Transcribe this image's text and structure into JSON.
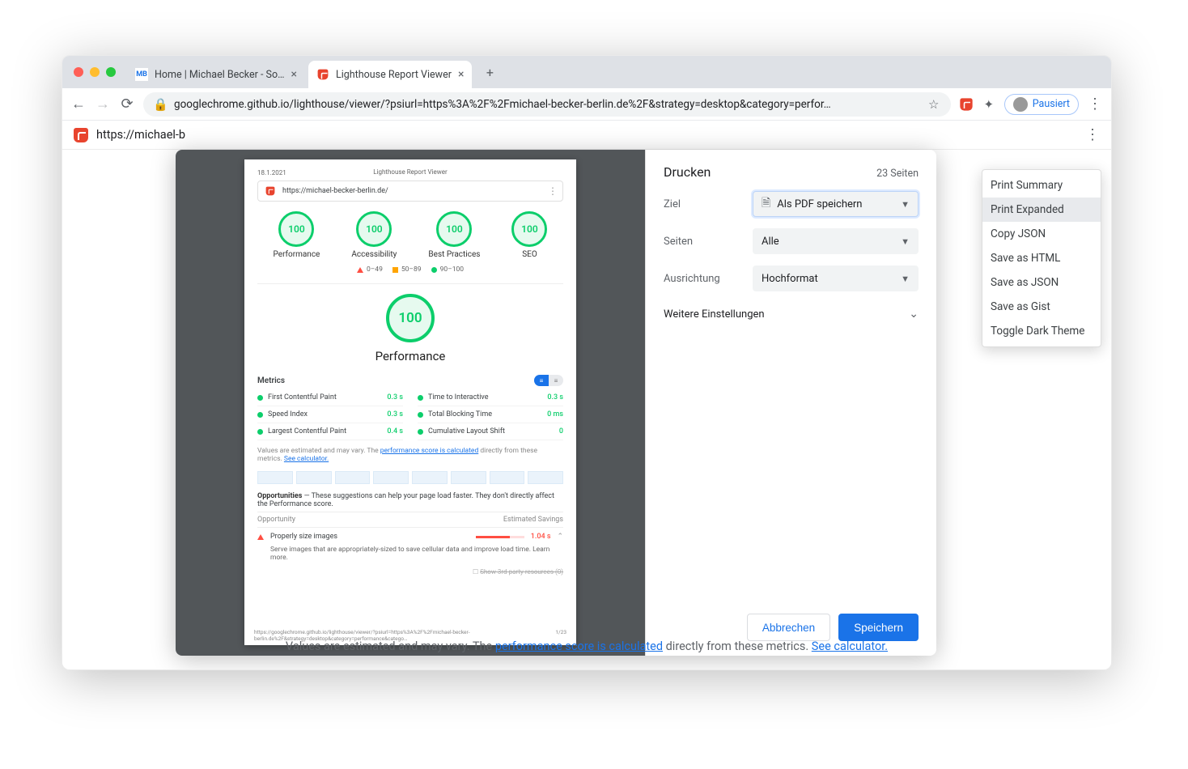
{
  "browser": {
    "tabs": [
      {
        "favicon_text": "MB",
        "title": "Home | Michael Becker - Softw"
      },
      {
        "favicon_text": "🏮",
        "title": "Lighthouse Report Viewer"
      }
    ],
    "url": "googlechrome.github.io/lighthouse/viewer/?psiurl=https%3A%2F%2Fmichael-becker-berlin.de%2F&strategy=desktop&category=perfor…",
    "profile_status": "Pausiert"
  },
  "sub_toolbar": {
    "url_text": "https://michael-b"
  },
  "dropdown": {
    "items": [
      "Print Summary",
      "Print Expanded",
      "Copy JSON",
      "Save as HTML",
      "Save as JSON",
      "Save as Gist",
      "Toggle Dark Theme"
    ],
    "selected_index": 1
  },
  "print": {
    "title": "Drucken",
    "page_count_label": "23 Seiten",
    "dest_label": "Ziel",
    "dest_value": "Als PDF speichern",
    "pages_label": "Seiten",
    "pages_value": "Alle",
    "orient_label": "Ausrichtung",
    "orient_value": "Hochformat",
    "more_label": "Weitere Einstellungen",
    "cancel": "Abbrechen",
    "save": "Speichern"
  },
  "preview": {
    "date": "18.1.2021",
    "title": "Lighthouse Report Viewer",
    "url": "https://michael-becker-berlin.de/",
    "gauges": [
      {
        "score": "100",
        "label": "Performance"
      },
      {
        "score": "100",
        "label": "Accessibility"
      },
      {
        "score": "100",
        "label": "Best Practices"
      },
      {
        "score": "100",
        "label": "SEO"
      }
    ],
    "legend": {
      "fail": "0–49",
      "avg": "50–89",
      "pass": "90–100"
    },
    "big_gauge": {
      "score": "100",
      "label": "Performance"
    },
    "metrics_label": "Metrics",
    "metrics": [
      {
        "name": "First Contentful Paint",
        "value": "0.3 s"
      },
      {
        "name": "Time to Interactive",
        "value": "0.3 s"
      },
      {
        "name": "Speed Index",
        "value": "0.3 s"
      },
      {
        "name": "Total Blocking Time",
        "value": "0 ms"
      },
      {
        "name": "Largest Contentful Paint",
        "value": "0.4 s"
      },
      {
        "name": "Cumulative Layout Shift",
        "value": "0"
      }
    ],
    "disclaimer_prefix": "Values are estimated and may vary. The ",
    "disclaimer_link1": "performance score is calculated",
    "disclaimer_mid": " directly from these metrics. ",
    "disclaimer_link2": "See calculator.",
    "opp_header": "Opportunities",
    "opp_sub": " — These suggestions can help your page load faster. They don't ",
    "opp_link": "directly affect",
    "opp_sub2": " the Performance score.",
    "opp_col_left": "Opportunity",
    "opp_col_right": "Estimated Savings",
    "opp_item": {
      "name": "Properly size images",
      "savings": "1.04 s"
    },
    "opp_detail": "Serve images that are appropriately-sized to save cellular data and improve load time. ",
    "opp_learn": "Learn more.",
    "third_party": "Show 3rd-party resources (0)",
    "footer_left": "https://googlechrome.github.io/lighthouse/viewer/?psiurl=https%3A%2F%2Fmichael-becker-berlin.de%2F&strategy=desktop&category=performance&catego…",
    "footer_right": "1/23"
  },
  "bottom_text": {
    "prefix": "Values are estimated and may vary. The ",
    "link1": "performance score is calculated",
    "mid": " directly from these metrics. ",
    "link2": "See calculator."
  }
}
